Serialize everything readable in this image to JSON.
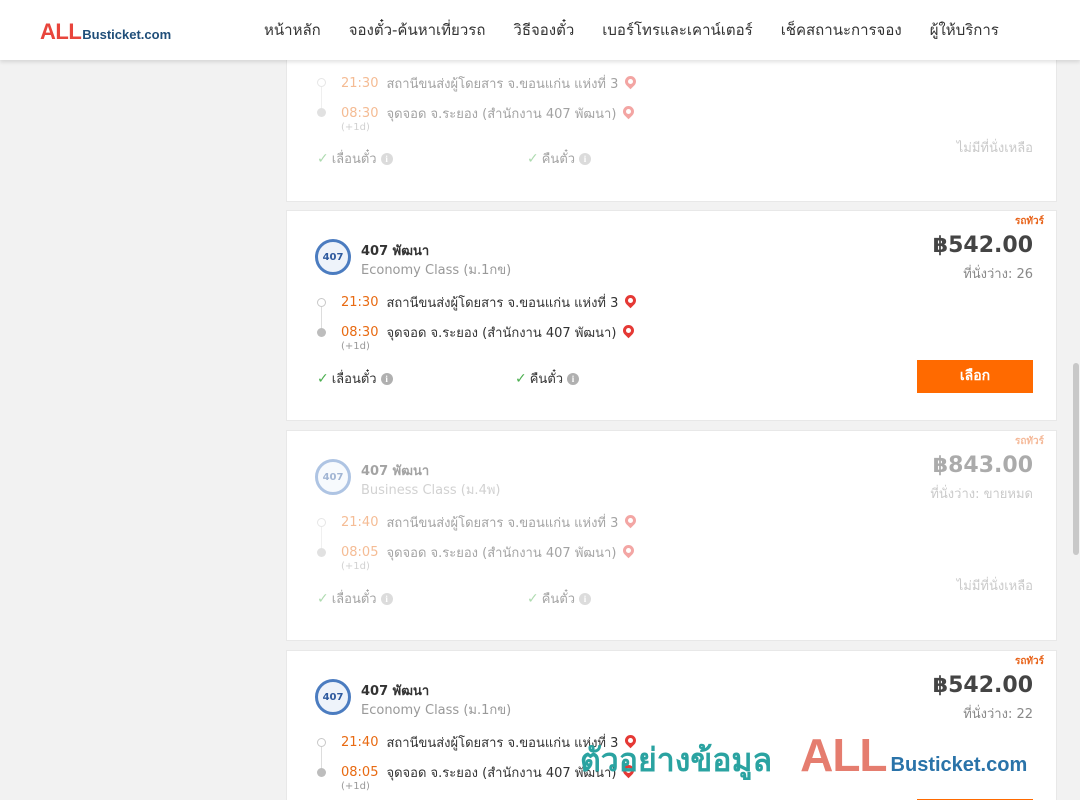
{
  "brand": {
    "logo_all": "ALL",
    "logo_rest": "Busticket.com"
  },
  "nav": [
    "หน้าหลัก",
    "จองตั๋ว-ค้นหาเที่ยวรถ",
    "วิธีจองตั๋ว",
    "เบอร์โทรและเคาน์เตอร์",
    "เช็คสถานะการจอง",
    "ผู้ให้บริการ"
  ],
  "cards": [
    {
      "tag": "",
      "operator": "",
      "class": "",
      "price": "",
      "seats": "",
      "depart_time": "21:30",
      "depart_place": "สถานีขนส่งผู้โดยสาร จ.ขอนแก่น แห่งที่ 3",
      "arrive_time": "08:30",
      "arrive_place": "จุดจอด จ.ระยอง (สำนักงาน 407 พัฒนา)",
      "next_day": "(+1d)",
      "reschedule": "เลื่อนตั๋ว",
      "refund": "คืนตั๋ว",
      "status": "ไม่มีที่นั่งเหลือ",
      "available": false
    },
    {
      "tag": "รถทัวร์",
      "operator": "407 พัฒนา",
      "class": "Economy Class (ม.1กข)",
      "price": "฿542.00",
      "seats": "ที่นั่งว่าง: 26",
      "depart_time": "21:30",
      "depart_place": "สถานีขนส่งผู้โดยสาร จ.ขอนแก่น แห่งที่ 3",
      "arrive_time": "08:30",
      "arrive_place": "จุดจอด จ.ระยอง (สำนักงาน 407 พัฒนา)",
      "next_day": "(+1d)",
      "reschedule": "เลื่อนตั๋ว",
      "refund": "คืนตั๋ว",
      "status": "เลือก",
      "available": true
    },
    {
      "tag": "รถทัวร์",
      "operator": "407 พัฒนา",
      "class": "Business Class (ม.4พ)",
      "price": "฿843.00",
      "seats": "ที่นั่งว่าง: ขายหมด",
      "depart_time": "21:40",
      "depart_place": "สถานีขนส่งผู้โดยสาร จ.ขอนแก่น แห่งที่ 3",
      "arrive_time": "08:05",
      "arrive_place": "จุดจอด จ.ระยอง (สำนักงาน 407 พัฒนา)",
      "next_day": "(+1d)",
      "reschedule": "เลื่อนตั๋ว",
      "refund": "คืนตั๋ว",
      "status": "ไม่มีที่นั่งเหลือ",
      "available": false
    },
    {
      "tag": "รถทัวร์",
      "operator": "407 พัฒนา",
      "class": "Economy Class (ม.1กข)",
      "price": "฿542.00",
      "seats": "ที่นั่งว่าง: 22",
      "depart_time": "21:40",
      "depart_place": "สถานีขนส่งผู้โดยสาร จ.ขอนแก่น แห่งที่ 3",
      "arrive_time": "08:05",
      "arrive_place": "จุดจอด จ.ระยอง (สำนักงาน 407 พัฒนา)",
      "next_day": "(+1d)",
      "reschedule": "",
      "refund": "",
      "status": "",
      "available": true
    }
  ],
  "operator_logo_text": "407",
  "info_glyph": "i",
  "check_glyph": "✓",
  "watermark": {
    "thai": "ตัวอย่างข้อมูล",
    "all": "ALL",
    "rest": "Busticket.com"
  },
  "colors": {
    "accent": "#ff6a00",
    "time": "#e86a12",
    "pin": "#e53935",
    "check": "#4caf50",
    "logo_red": "#e8453c",
    "logo_blue": "#1f4e79"
  }
}
